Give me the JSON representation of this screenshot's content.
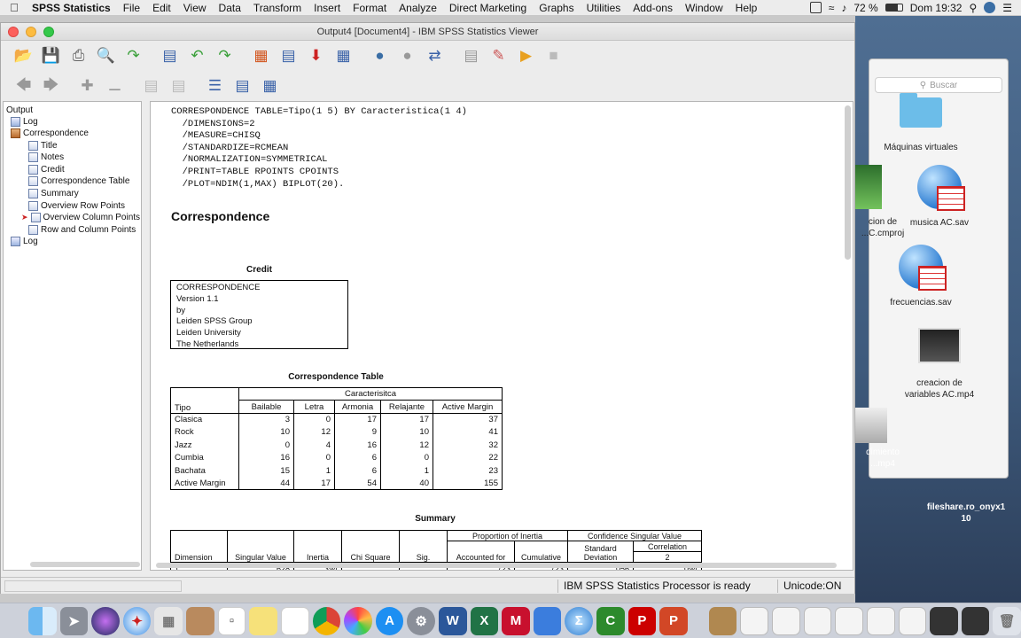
{
  "menubar": {
    "apple": "",
    "items": [
      "SPSS Statistics",
      "File",
      "Edit",
      "View",
      "Data",
      "Transform",
      "Insert",
      "Format",
      "Analyze",
      "Direct Marketing",
      "Graphs",
      "Utilities",
      "Add-ons",
      "Window",
      "Help"
    ],
    "battery": "72 %",
    "clock": "Dom 19:32"
  },
  "window": {
    "title": "Output4 [Document4] - IBM SPSS Statistics Viewer"
  },
  "outline": {
    "items": [
      "Output",
      "Log",
      "Correspondence",
      "Title",
      "Notes",
      "Credit",
      "Correspondence Table",
      "Summary",
      "Overview Row Points",
      "Overview Column Points",
      "Row and Column Points",
      "Log"
    ]
  },
  "content": {
    "syntax": "CORRESPONDENCE TABLE=Tipo(1 5) BY Caracteristica(1 4)\n  /DIMENSIONS=2\n  /MEASURE=CHISQ\n  /STANDARDIZE=RCMEAN\n  /NORMALIZATION=SYMMETRICAL\n  /PRINT=TABLE RPOINTS CPOINTS\n  /PLOT=NDIM(1,MAX) BIPLOT(20).",
    "heading": "Correspondence",
    "credit": {
      "caption": "Credit",
      "lines": [
        "CORRESPONDENCE",
        "Version 1.1",
        "by",
        "Leiden SPSS Group",
        "Leiden University",
        "The Netherlands"
      ]
    },
    "ctable": {
      "caption": "Correspondence Table",
      "col_group": "Caracterisitca",
      "row_header": "Tipo",
      "columns": [
        "Bailable",
        "Letra",
        "Armonia",
        "Relajante",
        "Active Margin"
      ],
      "rows": [
        {
          "label": "Clasica",
          "values": [
            "3",
            "0",
            "17",
            "17",
            "37"
          ]
        },
        {
          "label": "Rock",
          "values": [
            "10",
            "12",
            "9",
            "10",
            "41"
          ]
        },
        {
          "label": "Jazz",
          "values": [
            "0",
            "4",
            "16",
            "12",
            "32"
          ]
        },
        {
          "label": "Cumbia",
          "values": [
            "16",
            "0",
            "6",
            "0",
            "22"
          ]
        },
        {
          "label": "Bachata",
          "values": [
            "15",
            "1",
            "6",
            "1",
            "23"
          ]
        },
        {
          "label": "Active Margin",
          "values": [
            "44",
            "17",
            "54",
            "40",
            "155"
          ]
        }
      ]
    },
    "summary": {
      "caption": "Summary",
      "group_inertia": "Proportion of Inertia",
      "group_conf": "Confidence Singular Value",
      "col_dimension": "Dimension",
      "col_singular": "Singular Value",
      "col_inertia": "Inertia",
      "col_chisq": "Chi Square",
      "col_sig": "Sig.",
      "col_accounted": "Accounted for",
      "col_cumulative": "Cumulative",
      "col_stddev": "Standard Deviation",
      "col_corr": "Correlation",
      "col_corr_sub": "2",
      "row1": {
        "dim": "1",
        "singular": ",628",
        "inertia": ",394",
        "accounted": ",723",
        "cumulative": ",723",
        "stddev": ",056",
        "corr": ",094"
      }
    }
  },
  "status": {
    "processor": "IBM SPSS Statistics Processor is ready",
    "unicode": "Unicode:ON"
  },
  "desktop": {
    "search_placeholder": "Buscar",
    "items": [
      "Máquinas virtuales",
      "musica AC.sav",
      "frecuencias.sav",
      "creacion de variables AC.mp4",
      "cion de ...C.cmproj",
      "dimiento ...mp4",
      "fileshare.ro_onyx1 10"
    ]
  }
}
